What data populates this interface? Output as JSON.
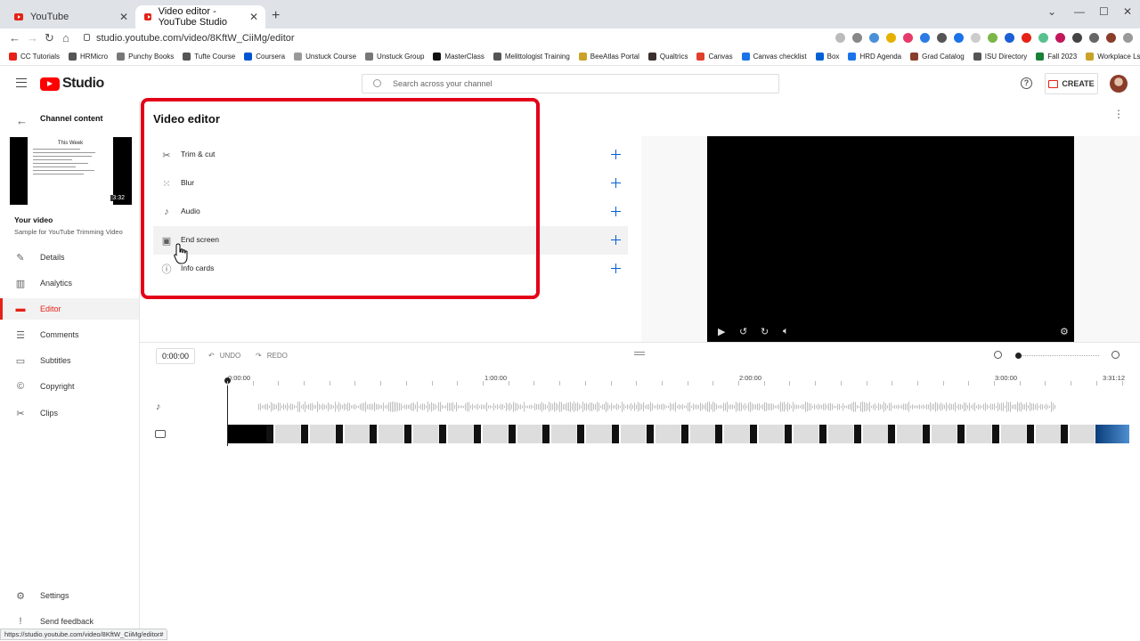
{
  "browser": {
    "tabs": [
      {
        "title": "YouTube",
        "active": false
      },
      {
        "title": "Video editor - YouTube Studio",
        "active": true
      }
    ],
    "url": "studio.youtube.com/video/8KftW_CiiMg/editor",
    "bookmarks": [
      {
        "label": "CC Tutorials",
        "color": "#e62117"
      },
      {
        "label": "HRMicro",
        "color": "#555555"
      },
      {
        "label": "Punchy Books",
        "color": "#777777"
      },
      {
        "label": "Tufte Course",
        "color": "#555555"
      },
      {
        "label": "Coursera",
        "color": "#0056d2"
      },
      {
        "label": "Unstuck Course",
        "color": "#999999"
      },
      {
        "label": "Unstuck Group",
        "color": "#777777"
      },
      {
        "label": "MasterClass",
        "color": "#111111"
      },
      {
        "label": "Melittologist Training",
        "color": "#555555"
      },
      {
        "label": "BeeAtlas Portal",
        "color": "#c9a227"
      },
      {
        "label": "Qualtrics",
        "color": "#3b2f2f"
      },
      {
        "label": "Canvas",
        "color": "#e13f2b"
      },
      {
        "label": "Canvas checklist",
        "color": "#1a73e8"
      },
      {
        "label": "Box",
        "color": "#0061d5"
      },
      {
        "label": "HRD Agenda",
        "color": "#1a73e8"
      },
      {
        "label": "Grad Catalog",
        "color": "#8a3d2a"
      },
      {
        "label": "ISU Directory",
        "color": "#555555"
      },
      {
        "label": "Fall 2023",
        "color": "#188038"
      },
      {
        "label": "Workplace Lshp Bk",
        "color": "#c9a227"
      }
    ],
    "status_url": "https://studio.youtube.com/video/8KftW_CiiMg/editor#"
  },
  "header": {
    "logo_text": "Studio",
    "search_placeholder": "Search across your channel",
    "help_glyph": "?",
    "create_label": "CREATE"
  },
  "sidebar": {
    "back_label": "Channel content",
    "thumbnail": {
      "title": "This Week",
      "duration": "3:32"
    },
    "your_video_label": "Your video",
    "video_title": "Sample for YouTube Trimming Video",
    "nav": [
      {
        "label": "Details",
        "icon": "pencil-icon",
        "active": false
      },
      {
        "label": "Analytics",
        "icon": "analytics-icon",
        "active": false
      },
      {
        "label": "Editor",
        "icon": "clapperboard-icon",
        "active": true
      },
      {
        "label": "Comments",
        "icon": "comments-icon",
        "active": false
      },
      {
        "label": "Subtitles",
        "icon": "subtitles-icon",
        "active": false
      },
      {
        "label": "Copyright",
        "icon": "copyright-icon",
        "active": false
      },
      {
        "label": "Clips",
        "icon": "scissors-icon",
        "active": false
      }
    ],
    "settings_label": "Settings",
    "feedback_label": "Send feedback"
  },
  "editor": {
    "title": "Video editor",
    "tools": [
      {
        "label": "Trim & cut",
        "icon": "scissors-icon"
      },
      {
        "label": "Blur",
        "icon": "blur-grid-icon"
      },
      {
        "label": "Audio",
        "icon": "music-note-icon"
      },
      {
        "label": "End screen",
        "icon": "end-screen-icon"
      },
      {
        "label": "Info cards",
        "icon": "info-icon"
      }
    ],
    "highlight_color": "#e30018"
  },
  "timeline": {
    "timecode": "0:00:00",
    "undo_label": "UNDO",
    "redo_label": "REDO",
    "ruler": [
      "0:00:00",
      "1:00:00",
      "2:00:00",
      "3:00:00",
      "3:31:12"
    ]
  },
  "colors": {
    "accent": "#e62117",
    "link_blue": "#065fd4"
  }
}
